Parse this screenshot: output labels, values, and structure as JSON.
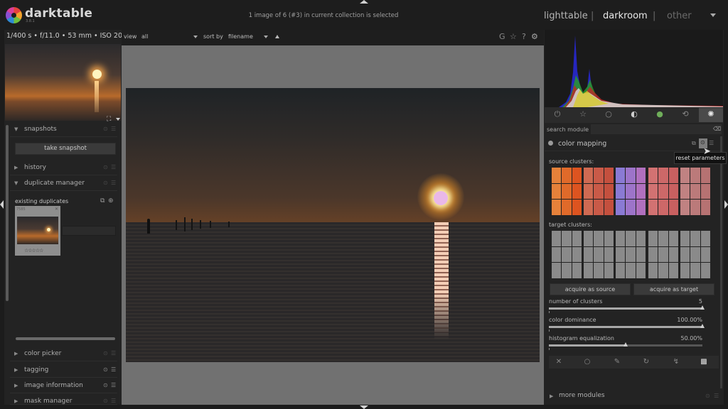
{
  "app": {
    "name": "darktable",
    "version": "3.8.1"
  },
  "header": {
    "collection_info": "1 image of 6 (#3) in current collection is selected",
    "views": {
      "lighttable": "lighttable",
      "darkroom": "darkroom",
      "other": "other",
      "separator": "|"
    }
  },
  "left": {
    "exif": "1/400 s • f/11.0 • 53 mm • ISO 200",
    "modules": {
      "snapshots": "snapshots",
      "history": "history",
      "duplicate_manager": "duplicate manager",
      "color_picker": "color picker",
      "tagging": "tagging",
      "image_information": "image information",
      "mask_manager": "mask manager"
    },
    "take_snapshot": "take snapshot",
    "existing_duplicates": "existing duplicates",
    "duplicate_thumb": {
      "id": "7585",
      "stars": "☆☆☆☆☆"
    }
  },
  "toolbar": {
    "view_label": "view",
    "view_value": "all",
    "sort_label": "sort by",
    "sort_value": "filename"
  },
  "right": {
    "search_label": "search module",
    "search_value": "",
    "module_title": "color mapping",
    "tooltip": "reset parameters",
    "source_label": "source clusters:",
    "target_label": "target clusters:",
    "acquire_source": "acquire as source",
    "acquire_target": "acquire as target",
    "sliders": [
      {
        "label": "number of clusters",
        "value": "5",
        "fraction": 1.0
      },
      {
        "label": "color dominance",
        "value": "100.00%",
        "fraction": 1.0
      },
      {
        "label": "histogram equalization",
        "value": "50.00%",
        "fraction": 0.5
      }
    ],
    "more_modules": "more modules"
  },
  "colors": {
    "source_clusters": [
      [
        "#e5813a",
        "#e06a2a",
        "#dd5420"
      ],
      [
        "#cf6a52",
        "#c95a48",
        "#c4503e"
      ],
      [
        "#8a7ad4",
        "#9d74c9",
        "#b070be"
      ],
      [
        "#d27272",
        "#cd6868",
        "#c86060"
      ],
      [
        "#c08282",
        "#bb7a7a",
        "#b67272"
      ]
    ],
    "target_cluster": "#8a8a8a"
  },
  "icons": {
    "module_groups": [
      "power-icon",
      "star-icon",
      "circle-icon",
      "half-circle-icon",
      "color-balls-icon",
      "loop-icon",
      "aperture-icon"
    ],
    "bottom_tools": [
      "close-icon",
      "circle-icon",
      "brush-icon",
      "path-icon",
      "drawn-icon",
      "checkerboard-icon"
    ]
  }
}
